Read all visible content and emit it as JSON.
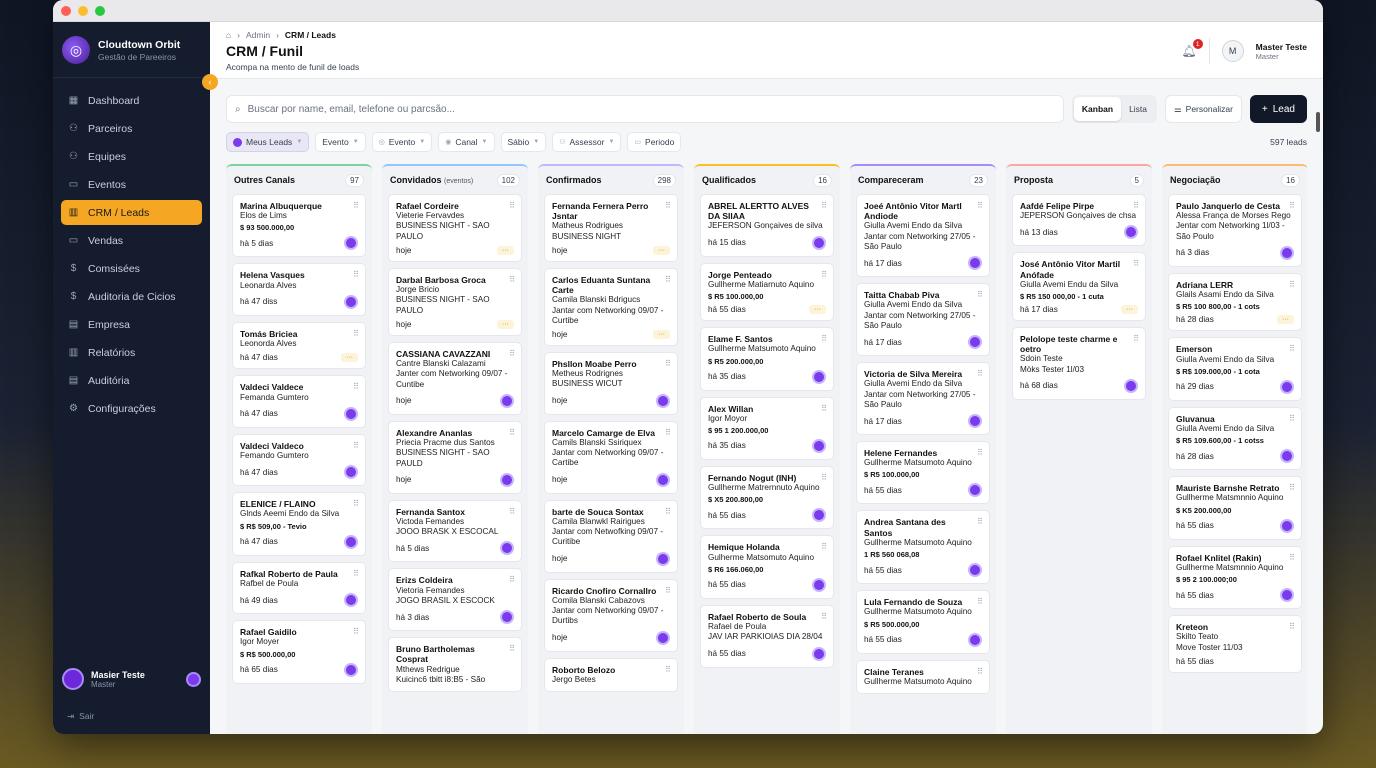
{
  "brand": {
    "name": "Cloudtown Orbit",
    "sub": "Gestão de Pareeiros"
  },
  "sidebar": {
    "items": [
      {
        "label": "Dashboard",
        "icon": "▦",
        "active": false
      },
      {
        "label": "Parceiros",
        "icon": "⚇",
        "active": false
      },
      {
        "label": "Equipes",
        "icon": "⚇",
        "active": false
      },
      {
        "label": "Eventos",
        "icon": "▭",
        "active": false
      },
      {
        "label": "CRM / Leads",
        "icon": "▥",
        "active": true
      },
      {
        "label": "Vendas",
        "icon": "▭",
        "active": false
      },
      {
        "label": "Comsisées",
        "icon": "$",
        "active": false
      },
      {
        "label": "Auditoria de Cicios",
        "icon": "$",
        "active": false
      },
      {
        "label": "Empresa",
        "icon": "▤",
        "active": false
      },
      {
        "label": "Relatórios",
        "icon": "▥",
        "active": false
      },
      {
        "label": "Auditória",
        "icon": "▤",
        "active": false
      },
      {
        "label": "Configurações",
        "icon": "⚙",
        "active": false
      }
    ],
    "user": {
      "name": "Masier Teste",
      "role": "Master"
    },
    "logout": "Sair"
  },
  "header": {
    "breadcrumb": [
      "Admin",
      "CRM / Leads"
    ],
    "title": "CRM / Funil",
    "subtitle": "Acompa na mento de funil de loads",
    "notifications": "1",
    "user": {
      "initial": "M",
      "name": "Master Teste",
      "role": "Master"
    }
  },
  "toolbar": {
    "search_placeholder": "Buscar por name, email, telefone ou parcsão...",
    "view_kanban": "Kanban",
    "view_list": "Lista",
    "customize": "Personalizar",
    "add_lead": "Lead"
  },
  "filters": [
    "Meus Leads",
    "Evento",
    "Evento",
    "Canal",
    "Sábio",
    "Assessor",
    "Periodo"
  ],
  "lead_count": "597 leads",
  "columns": [
    {
      "title": "Outres Canals",
      "sub": "",
      "count": "97",
      "cards": [
        {
          "name": "Marina Albuquerque",
          "lines": [
            "Elos de Lims"
          ],
          "value": "$ 93 500.000,00",
          "time": "hà 5 dias",
          "badge": "avatar"
        },
        {
          "name": "Helena Vasques",
          "lines": [
            "Leonarda Alves"
          ],
          "value": "",
          "time": "há 47 diss",
          "badge": "avatar"
        },
        {
          "name": "Tomás Briciea",
          "lines": [
            "Leonorda Alves"
          ],
          "value": "",
          "time": "há 47 dias",
          "badge": "pending"
        },
        {
          "name": "Valdeci Valdece",
          "lines": [
            "Femanda Gumtero"
          ],
          "value": "",
          "time": "há 47 dias",
          "badge": "avatar"
        },
        {
          "name": "Valdeci Valdeco",
          "lines": [
            "Femando Gumtero"
          ],
          "value": "",
          "time": "há 47 dias",
          "badge": "avatar"
        },
        {
          "name": "ELENICE / FLAINO",
          "lines": [
            "Glnds Aeemi Endo da Silva"
          ],
          "value": "$ R$ 509,00 - Tevio",
          "time": "há 47 dias",
          "badge": "avatar"
        },
        {
          "name": "Rafkal Roberto de Paula",
          "lines": [
            "Rafbel de Poula"
          ],
          "value": "",
          "time": "há 49 dias",
          "badge": "avatar"
        },
        {
          "name": "Rafael Gaidilo",
          "lines": [
            "Igor Moyer"
          ],
          "value": "$ R$ 500.000,00",
          "time": "há 65 dias",
          "badge": "avatar"
        }
      ]
    },
    {
      "title": "Convidados",
      "sub": "(eventos)",
      "count": "102",
      "cards": [
        {
          "name": "Rafael Cordeire",
          "lines": [
            "Vieterie Fervavdes",
            "BUSINESS NIGHT - SAO PAULO"
          ],
          "value": "",
          "time": "hoje",
          "badge": "pending"
        },
        {
          "name": "Darbal Barbosa Groca",
          "lines": [
            "Jorge Bricio",
            "BUSINESS NIGHT - SAO PAULO"
          ],
          "value": "",
          "time": "hoje",
          "badge": "pending"
        },
        {
          "name": "CASSIANA CAVAZZANI",
          "lines": [
            "Cantre Blanski Calazami",
            "Janter com Networking 09/07 - Cuntibe"
          ],
          "value": "",
          "time": "hoje",
          "badge": "avatar"
        },
        {
          "name": "Alexandre Ananlas",
          "lines": [
            "Priecia Pracme dus Santos",
            "BUSINESS NIGHT - SAO PAULD"
          ],
          "value": "",
          "time": "hoje",
          "badge": "avatar"
        },
        {
          "name": "Fernanda Santox",
          "lines": [
            "Victoda Femandes",
            "JOOO BRASK X ESCOCAL"
          ],
          "value": "",
          "time": "há 5 dias",
          "badge": "avatar"
        },
        {
          "name": "Erizs Coldeira",
          "lines": [
            "Vietoria Femandes",
            "JOGO BRASIL X ESCOCK"
          ],
          "value": "",
          "time": "há 3 dias",
          "badge": "avatar"
        },
        {
          "name": "Bruno Bartholemas Cosprat",
          "lines": [
            "Mthews Redrigue",
            "Kuicinc6 tbitt i8:B5 - São"
          ],
          "value": "",
          "time": "",
          "badge": ""
        }
      ]
    },
    {
      "title": "Confirmados",
      "sub": "",
      "count": "298",
      "cards": [
        {
          "name": "Fernanda Fernera Perro Jsntar",
          "lines": [
            "Matheus Rodrigues",
            "BUSINESS NIGHT"
          ],
          "value": "",
          "time": "hoje",
          "badge": "pending"
        },
        {
          "name": "Carlos Eduanta Suntana Carte",
          "lines": [
            "Camila Blanski Bdrigucs",
            "Jantar com Networking 09/07 - Curtibe"
          ],
          "value": "",
          "time": "hoje",
          "badge": "pending"
        },
        {
          "name": "Phsllon Moabe Perro",
          "lines": [
            "Metheus Rodrignes",
            "BUSINESS WICUT"
          ],
          "value": "",
          "time": "hoje",
          "badge": "avatar"
        },
        {
          "name": "Marcelo Camarge de Elva",
          "lines": [
            "Camils Blanski Ssiriquex",
            "Jantar com Networking 09/07 - Cartibe"
          ],
          "value": "",
          "time": "hoje",
          "badge": "avatar"
        },
        {
          "name": "barte de Souca Sontax",
          "lines": [
            "Camila Blanwkl Rairigues",
            "Jantar com Netwofking 09/07 - Curitibe"
          ],
          "value": "",
          "time": "hoje",
          "badge": "avatar"
        },
        {
          "name": "Ricardo Cnofiro Cornallro",
          "lines": [
            "Comila Blanski Cabazovs",
            "Jantar com Networking 09/07 - Durtibs"
          ],
          "value": "",
          "time": "hoje",
          "badge": "avatar"
        },
        {
          "name": "Roborto Belozo",
          "lines": [
            "Jergo Betes"
          ],
          "value": "",
          "time": "",
          "badge": ""
        }
      ]
    },
    {
      "title": "Qualificados",
      "sub": "",
      "count": "16",
      "cards": [
        {
          "name": "ABREL ALERTTO ALVES DA SIIAA",
          "lines": [
            "JEFERSON Gonçaives de silva"
          ],
          "value": "",
          "time": "há 15 dias",
          "badge": "avatar"
        },
        {
          "name": "Jorge Penteado",
          "lines": [
            "Gullherme Matiarnuto Aquino"
          ],
          "value": "$ R5 100.000,00",
          "time": "há 55 dias",
          "badge": "pending"
        },
        {
          "name": "Elame F. Santos",
          "lines": [
            "Gullherme Matsumoto Aquino"
          ],
          "value": "$ R5 200.000,00",
          "time": "há 35 dias",
          "badge": "avatar"
        },
        {
          "name": "Alex Willan",
          "lines": [
            "Igor Moyor"
          ],
          "value": "$ 95 1 200.000,00",
          "time": "há 35 dias",
          "badge": "avatar"
        },
        {
          "name": "Fernando Nogut (INH)",
          "lines": [
            "Gullherme Matrernnuto Aquino"
          ],
          "value": "$ X5 200.800,00",
          "time": "há 55 dias",
          "badge": "avatar"
        },
        {
          "name": "Hemique Holanda",
          "lines": [
            "Gulherme Matsomuto Aquino"
          ],
          "value": "$ R6 166.060,00",
          "time": "há 55 dias",
          "badge": "avatar"
        },
        {
          "name": "Rafael Roberto de Soula",
          "lines": [
            "Rafael de Poula",
            "JAV IAR PARKIOIAS DIA 28/04"
          ],
          "value": "",
          "time": "há 55 dias",
          "badge": "avatar"
        }
      ]
    },
    {
      "title": "Compareceram",
      "sub": "",
      "count": "23",
      "cards": [
        {
          "name": "Joeé Antônio Vitor Martl Andiode",
          "lines": [
            "Giulla Avemi Endo da Silva",
            "Jantar com Networking 27/05 - São Paulo"
          ],
          "value": "",
          "time": "há 17 dias",
          "badge": "avatar"
        },
        {
          "name": "Taitta Chabab Piva",
          "lines": [
            "Giulla Avemi Endo da Silva",
            "Jantar com Networking 27/05 - São Paulo"
          ],
          "value": "",
          "time": "há 17 dias",
          "badge": "avatar"
        },
        {
          "name": "Victoria de Silva Mereira",
          "lines": [
            "Giulla Avemi Endo da Silva",
            "Jantar com Networking 27/05 - São Paulo"
          ],
          "value": "",
          "time": "há 17 dias",
          "badge": "avatar"
        },
        {
          "name": "Helene Fernandes",
          "lines": [
            "Gullherme Matsumoto Aquino"
          ],
          "value": "$ R5 100.000,00",
          "time": "há 55 dias",
          "badge": "avatar"
        },
        {
          "name": "Andrea Santana des Santos",
          "lines": [
            "Gullherme Matsumoto Aquino"
          ],
          "value": "1 R$ 560 068,08",
          "time": "há 55 dias",
          "badge": "avatar"
        },
        {
          "name": "Lula Fernando de Souza",
          "lines": [
            "Gullherme Matsumoto Aquino"
          ],
          "value": "$ R5 500.000,00",
          "time": "há 55 dias",
          "badge": "avatar"
        },
        {
          "name": "Claine Teranes",
          "lines": [
            "Gullherme Matsumoto Aquino"
          ],
          "value": "",
          "time": "",
          "badge": ""
        }
      ]
    },
    {
      "title": "Proposta",
      "sub": "",
      "count": "5",
      "cards": [
        {
          "name": "Aafdé Felipe Pirpe",
          "lines": [
            "JEPERSON Gonçaives de chsa"
          ],
          "value": "",
          "time": "há 13 dias",
          "badge": "avatar"
        },
        {
          "name": "José Antônio Vitor Martil Anófade",
          "lines": [
            "Giulla Avemi Endu da Silva"
          ],
          "value": "$ R5 150 000,00 - 1 cuta",
          "time": "há 17 dias",
          "badge": "pending"
        },
        {
          "name": "Pelolope teste charme e oetro",
          "lines": [
            "Sdoin Teste",
            "Mòks Tester 1l/03"
          ],
          "value": "",
          "time": "há 68 dias",
          "badge": "avatar"
        }
      ]
    },
    {
      "title": "Negociação",
      "sub": "",
      "count": "16",
      "cards": [
        {
          "name": "Paulo Janquerlo de Cesta",
          "lines": [
            "Alessa França de Morses Rego",
            "Jentar com Networking 1l/03 - São Poulo"
          ],
          "value": "",
          "time": "há 3 dias",
          "badge": "avatar"
        },
        {
          "name": "Adriana LERR",
          "lines": [
            "Glails Asami Endo da Silva"
          ],
          "value": "$ R5 100 800,00 - 1 cots",
          "time": "há 28 dias",
          "badge": "pending"
        },
        {
          "name": "Emerson",
          "lines": [
            "Giulla Avemi Endo da Silva"
          ],
          "value": "$ R$ 109.000,00 - 1 cota",
          "time": "há 29 dias",
          "badge": "avatar"
        },
        {
          "name": "Gluvanua",
          "lines": [
            "Giulla Avemi Endo da Silva"
          ],
          "value": "$ R5 109.600,00 - 1 cotss",
          "time": "há 28 dias",
          "badge": "avatar"
        },
        {
          "name": "Mauriste Barnshe Retrato",
          "lines": [
            "Gullherme Matsmnnio Aquino"
          ],
          "value": "$ K5 200.000,00",
          "time": "há 55 dias",
          "badge": "avatar"
        },
        {
          "name": "Rofael Knlitel (Rakin)",
          "lines": [
            "Gullherme Matsmnnio Aquino"
          ],
          "value": "$ 95 2 100.000;00",
          "time": "há 55 dias",
          "badge": "avatar"
        },
        {
          "name": "Kreteon",
          "lines": [
            "Skilto Teato",
            "Move Toster 11/03"
          ],
          "value": "",
          "time": "há 55 dias",
          "badge": ""
        }
      ]
    }
  ]
}
